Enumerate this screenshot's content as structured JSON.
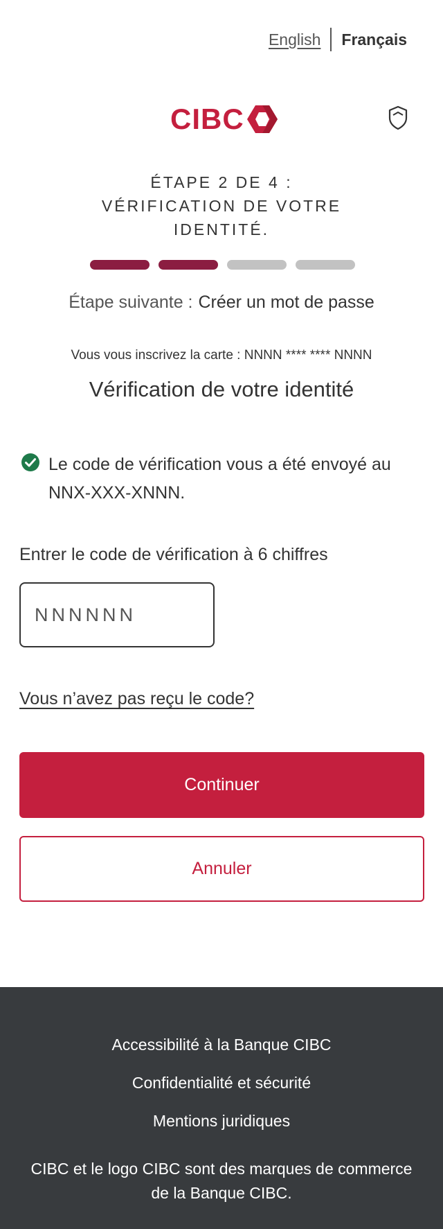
{
  "language": {
    "english": "English",
    "french": "Français"
  },
  "brand": {
    "logo_text": "CIBC",
    "color": "#c41f3e"
  },
  "step": {
    "title_line1": "ÉTAPE 2 DE 4 :",
    "title_line2": "VÉRIFICATION DE VOTRE",
    "title_line3": "IDENTITÉ.",
    "current": 2,
    "total": 4,
    "next_label": "Étape suivante :",
    "next_value": "Créer un mot de passe"
  },
  "card_line": "Vous vous inscrivez la carte : NNNN **** **** NNNN",
  "heading": "Vérification de votre identité",
  "notice": {
    "text": "Le code de vérification vous a été envoyé au NNX-XXX-XNNN.",
    "icon": "check-circle-icon",
    "color": "#1e7a4a"
  },
  "code": {
    "label": "Entrer le code de vérification à 6 chiffres",
    "placeholder": "NNNNNN"
  },
  "resend_link": "Vous n’avez pas reçu le code?",
  "buttons": {
    "continue": "Continuer",
    "cancel": "Annuler"
  },
  "footer": {
    "links": [
      "Accessibilité à la Banque CIBC",
      "Confidentialité et sécurité",
      "Mentions juridiques"
    ],
    "note": "CIBC et le logo CIBC sont des marques de commerce de la Banque CIBC."
  }
}
